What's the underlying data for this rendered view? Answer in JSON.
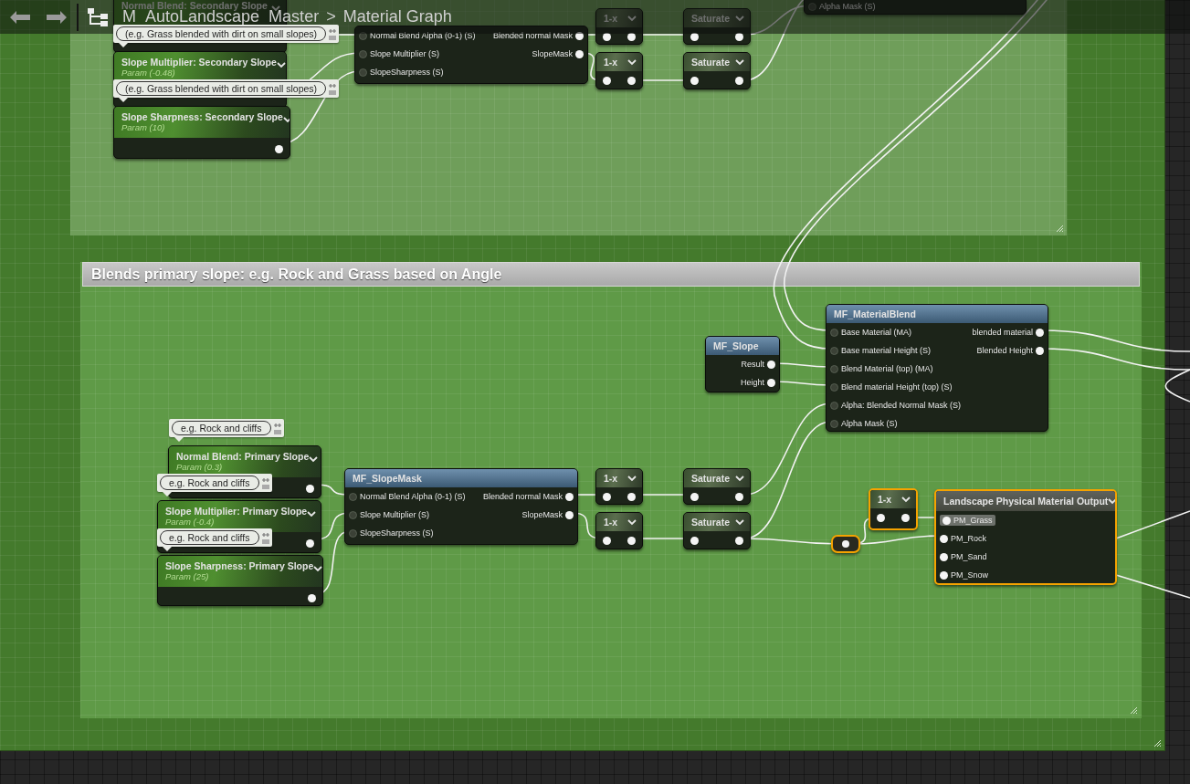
{
  "toolbar": {
    "asset": "M_AutoLandscape_Master",
    "separator": ">",
    "graph": "Material Graph"
  },
  "comment_box": {
    "title": "Blends primary slope: e.g. Rock and Grass based on Angle"
  },
  "nodes": [
    {
      "kind": "param",
      "title": "Normal Blend: Secondary Slope",
      "selected": false
    },
    {
      "kind": "param",
      "title": "Slope Multiplier: Secondary Slope",
      "subtitle": "Param (-0.48)",
      "comment": "(e.g. Grass blended with dirt on small slopes)",
      "selected": false
    },
    {
      "kind": "param",
      "title": "Slope Sharpness: Secondary Slope",
      "subtitle": "Param (10)",
      "comment": "(e.g. Grass blended with dirt on small slopes)",
      "selected": false
    },
    {
      "kind": "function",
      "inputs": [
        {
          "label": "Normal Blend Alpha (0-1) (S)"
        },
        {
          "label": "Slope Multiplier (S)"
        },
        {
          "label": "SlopeSharpness (S)"
        }
      ],
      "outputs": [
        {
          "label": "Blended normal Mask"
        },
        {
          "label": "SlopeMask"
        }
      ],
      "selected": false
    },
    {
      "kind": "math",
      "title": "1-x",
      "selected": false
    },
    {
      "kind": "math",
      "title": "1-x",
      "selected": false
    },
    {
      "kind": "math",
      "title": "Saturate",
      "selected": false
    },
    {
      "kind": "math",
      "title": "Saturate",
      "selected": false
    },
    {
      "kind": "function",
      "inputs": [
        {
          "label": "Alpha Mask (S)"
        }
      ],
      "selected": false
    },
    {
      "kind": "param",
      "title": "Normal Blend: Primary Slope",
      "subtitle": "Param (0.3)",
      "comment": "e.g. Rock and cliffs",
      "selected": false
    },
    {
      "kind": "param",
      "title": "Slope Multiplier: Primary Slope",
      "subtitle": "Param (-0.4)",
      "comment": "e.g. Rock and cliffs",
      "selected": false
    },
    {
      "kind": "param",
      "title": "Slope Sharpness: Primary Slope",
      "subtitle": "Param (25)",
      "comment": "e.g. Rock and cliffs",
      "selected": false
    },
    {
      "kind": "function",
      "title": "MF_SlopeMask",
      "inputs": [
        {
          "label": "Normal Blend Alpha (0-1) (S)"
        },
        {
          "label": "Slope Multiplier (S)"
        },
        {
          "label": "SlopeSharpness (S)"
        }
      ],
      "outputs": [
        {
          "label": "Blended normal Mask"
        },
        {
          "label": "SlopeMask"
        }
      ],
      "selected": false
    },
    {
      "kind": "math",
      "title": "1-x",
      "selected": false
    },
    {
      "kind": "math",
      "title": "1-x",
      "selected": false
    },
    {
      "kind": "math",
      "title": "Saturate",
      "selected": false
    },
    {
      "kind": "math",
      "title": "Saturate",
      "selected": false
    },
    {
      "kind": "function",
      "title": "MF_Slope",
      "outputs": [
        {
          "label": "Result"
        },
        {
          "label": "Height"
        }
      ],
      "selected": false
    },
    {
      "kind": "function",
      "title": "MF_MaterialBlend",
      "inputs": [
        {
          "label": "Base Material (MA)"
        },
        {
          "label": "Base material Height (S)"
        },
        {
          "label": "Blend Material (top) (MA)"
        },
        {
          "label": "Blend material Height (top) (S)"
        },
        {
          "label": "Alpha: Blended Normal Mask (S)"
        },
        {
          "label": "Alpha Mask (S)"
        }
      ],
      "outputs": [
        {
          "label": "blended material"
        },
        {
          "label": "Blended Height"
        }
      ],
      "selected": false
    },
    {
      "kind": "reroute",
      "selected": true
    },
    {
      "kind": "math",
      "title": "1-x",
      "selected": true
    },
    {
      "kind": "output",
      "title": "Landscape Physical Material Output",
      "inputs": [
        {
          "label": "PM_Grass",
          "highlighted": true
        },
        {
          "label": "PM_Rock",
          "highlighted": false
        },
        {
          "label": "PM_Sand",
          "highlighted": false
        },
        {
          "label": "PM_Snow",
          "highlighted": false
        }
      ],
      "selected": true
    }
  ]
}
